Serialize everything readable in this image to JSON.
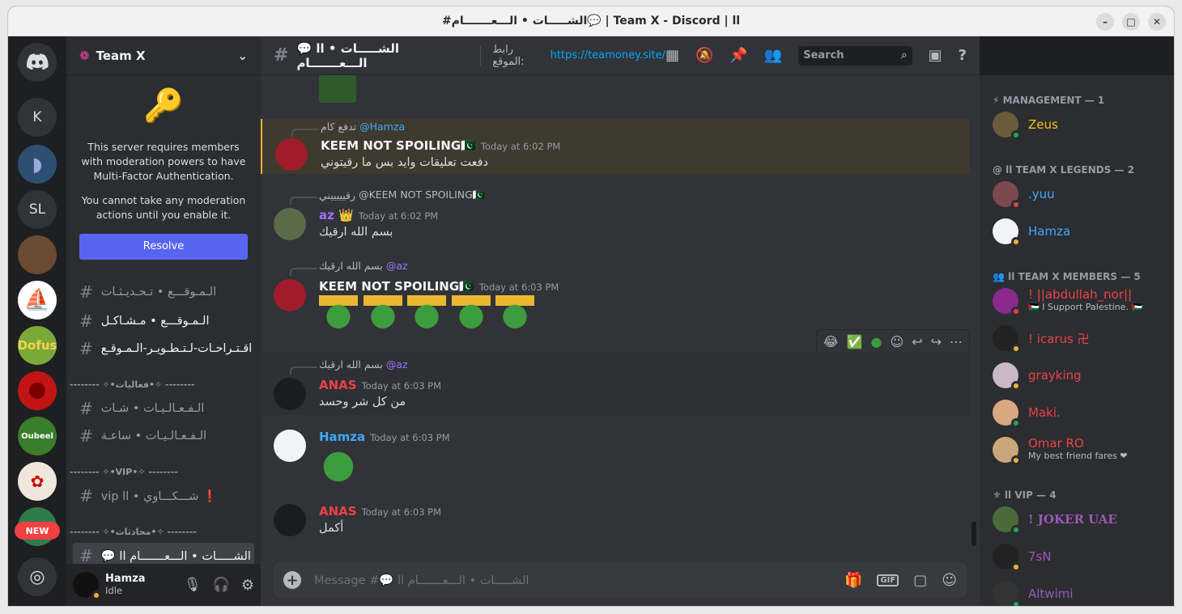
{
  "window": {
    "title": "#الشـــــات • الـــعـــــــام💬 | Team X - Discord | ⅼⅼ"
  },
  "guilds": {
    "k": "K",
    "sl": "SL",
    "new_badge": "NEW"
  },
  "server": {
    "name": "Team X",
    "mfa_text1": "This server requires members with moderation powers to have Multi-Factor Authentication.",
    "mfa_text2": "You cannot take any moderation actions until you enable it.",
    "resolve": "Resolve",
    "channels": [
      "الـمـوقـــع • تـحـديـثـات",
      "الـمـوقـــع • مـشـاكـل",
      "اقـتـراحـات-لـتـطـويـر-الـمـوقـع",
      "الـفـعـالـيـات • شـات",
      "الـفـعـالـيـات • ساعـة",
      "vip ⅼⅼ • شـــكـــاوي ❗",
      "💬 ⅼⅼ الشـــــات • الـــعـــــــام"
    ],
    "cat_events": "-------- ✧•فعاليات•✧ --------",
    "cat_vip": "-------- ✧•VIP•✧ --------",
    "cat_chat": "-------- ✧•محادثات•✧ --------"
  },
  "user": {
    "name": "Hamza",
    "status": "Idle"
  },
  "channel": {
    "name": "💬 ⅼⅼ الشـــــات • الـــعـــــــام",
    "topic_label": "رابط الموقع:",
    "topic_link": "https://teamoney.site/",
    "search": "Search"
  },
  "messages": [
    {
      "reply_name": "@Hamza",
      "reply_text": "تدفع كام",
      "author": "KEEM NOT SPOILING🇵🇰",
      "time": "Today at 6:02 PM",
      "text": "دفعت تعليقات وايد بس ما رقيتوني"
    },
    {
      "reply_name": "@KEEM NOT SPOILING🇵🇰",
      "reply_text": "رقيييييني",
      "author": "az 👑",
      "time": "Today at 6:02 PM",
      "text": "بسم الله ارقيك"
    },
    {
      "reply_name": "@az",
      "reply_text": "بسم الله ارقيك",
      "author": "KEEM NOT SPOILING🇵🇰",
      "time": "Today at 6:03 PM",
      "text": ""
    },
    {
      "reply_name": "@az",
      "reply_text": "بسم الله ارقيك",
      "author": "ANAS",
      "time": "Today at 6:03 PM",
      "text": "من كل شر وحسد"
    },
    {
      "reply_name": "",
      "reply_text": "",
      "author": "Hamza",
      "time": "Today at 6:03 PM",
      "text": ""
    },
    {
      "reply_name": "",
      "reply_text": "",
      "author": "ANAS",
      "time": "Today at 6:03 PM",
      "text": "أكمل"
    }
  ],
  "composer": {
    "placeholder": "Message #💬 ⅼⅼ الشـــــات • الـــعـــــــام"
  },
  "members": {
    "groups": [
      {
        "title": "⚡ MANAGEMENT — 1",
        "items": [
          {
            "name": "Zeus",
            "sub": "",
            "color": "#f1c40f",
            "status": "#23a55a"
          }
        ]
      },
      {
        "title": "@ ⅼⅼ TEAM X LEGENDS — 2",
        "items": [
          {
            "name": ".yuu",
            "sub": "",
            "color": "#3ea8ff",
            "status": "#f23f43"
          },
          {
            "name": "Hamza",
            "sub": "",
            "color": "#3ea8ff",
            "status": "#f0b232"
          }
        ]
      },
      {
        "title": "👥 ⅼⅼ TEAM X MEMBERS — 5",
        "items": [
          {
            "name": "! ||abdullah_nor||",
            "sub": "🇵🇸 I Support Palestine. 🇵🇸",
            "color": "#ed4245",
            "status": "#f23f43"
          },
          {
            "name": "! icarus 卍",
            "sub": "",
            "color": "#ed4245",
            "status": "#f0b232"
          },
          {
            "name": "grayking",
            "sub": "",
            "color": "#ed4245",
            "status": "#f0b232"
          },
          {
            "name": "Maki.",
            "sub": "",
            "color": "#ed4245",
            "status": "#23a55a"
          },
          {
            "name": "Omar RO",
            "sub": "My best friend fares ❤",
            "color": "#ed4245",
            "status": "#f0b232"
          }
        ]
      },
      {
        "title": "⚜ ⅼⅼ VIP — 4",
        "items": [
          {
            "name": "! JOKER UAE",
            "sub": "",
            "color": "#9b59b6",
            "status": "#23a55a"
          },
          {
            "name": "7sN",
            "sub": "",
            "color": "#9b59b6",
            "status": "#f0b232"
          },
          {
            "name": "Altwimi",
            "sub": "",
            "color": "#9b59b6",
            "status": "#23a55a"
          }
        ]
      }
    ]
  },
  "colors": {
    "keem": "#f2f3f5",
    "az": "#a070ff",
    "anas": "#ed4245",
    "hamza": "#3ea8ff"
  }
}
